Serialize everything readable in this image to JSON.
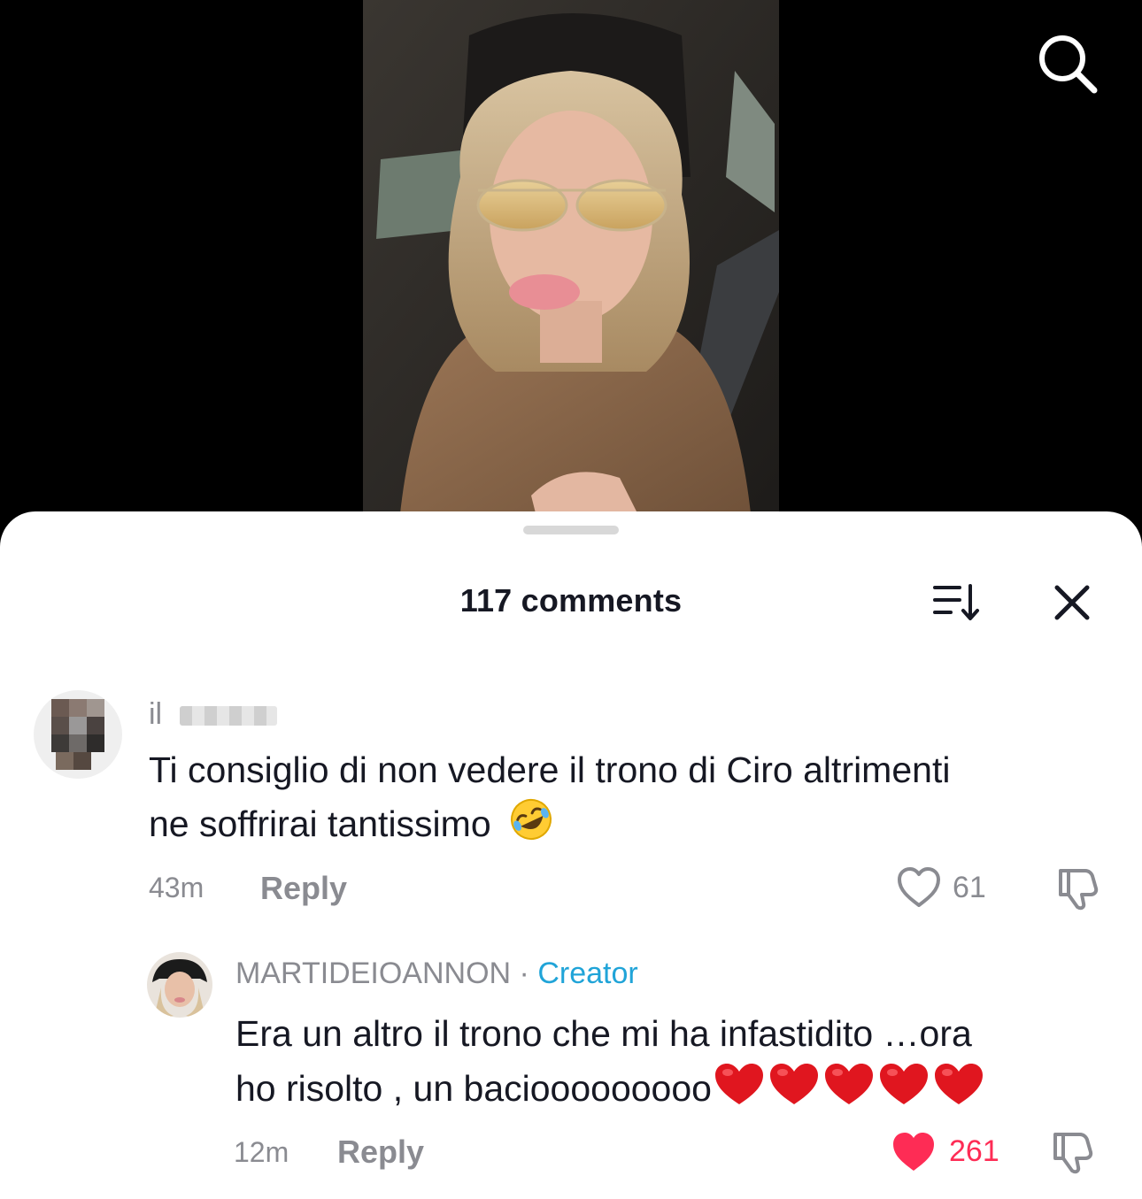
{
  "header": {
    "search_icon": "search-icon"
  },
  "sheet": {
    "title": "117 comments",
    "sort_icon": "sort-icon",
    "close_icon": "close-icon"
  },
  "comments": [
    {
      "username": "il",
      "text_line1": "Ti consiglio di non vedere il trono di Ciro altrimenti",
      "text_line2": "ne soffrirai tantissimo",
      "emoji": "rolling-on-floor-laughing",
      "time": "43m",
      "reply_label": "Reply",
      "likes": "61",
      "liked": false
    },
    {
      "username": "MARTIDEIOANNON",
      "separator": "·",
      "badge": "Creator",
      "text_line1": "Era un altro il trono che mi ha infastidito …ora",
      "text_line2": "ho risolto , un baciooooooooo",
      "emoji": "red-heart x5",
      "time": "12m",
      "reply_label": "Reply",
      "likes": "261",
      "liked": true
    }
  ],
  "colors": {
    "accent_like": "#fe2c55",
    "creator_badge": "#20a4d8",
    "muted_text": "#8a8b91",
    "text": "#161823"
  }
}
